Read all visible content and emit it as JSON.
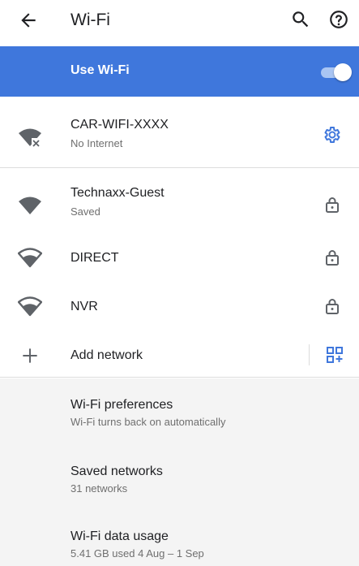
{
  "header": {
    "title": "Wi-Fi",
    "icons": [
      "back-arrow-icon",
      "search-icon",
      "help-icon"
    ]
  },
  "toggle": {
    "label": "Use Wi-Fi",
    "on": true,
    "accent": "#3f77dc"
  },
  "connected": {
    "name": "CAR-WIFI-XXXX",
    "status": "No Internet",
    "icon": "wifi-no-internet-icon",
    "action_icon": "settings-gear-icon",
    "gear_color": "#3f77dc"
  },
  "networks": [
    {
      "name": "Technaxx-Guest",
      "status": "Saved",
      "icon": "wifi-full-icon",
      "locked": true
    },
    {
      "name": "DIRECT",
      "status": "",
      "icon": "wifi-medium-icon",
      "locked": true
    },
    {
      "name": "NVR",
      "status": "",
      "icon": "wifi-medium-icon",
      "locked": true
    }
  ],
  "add_network": {
    "label": "Add network",
    "icon": "plus-icon",
    "action_icon": "qr-code-scanner-icon"
  },
  "preferences": [
    {
      "title": "Wi-Fi preferences",
      "subtitle": "Wi-Fi turns back on automatically"
    },
    {
      "title": "Saved networks",
      "subtitle": "31 networks"
    },
    {
      "title": "Wi-Fi data usage",
      "subtitle": "5.41 GB used 4 Aug – 1 Sep"
    }
  ]
}
